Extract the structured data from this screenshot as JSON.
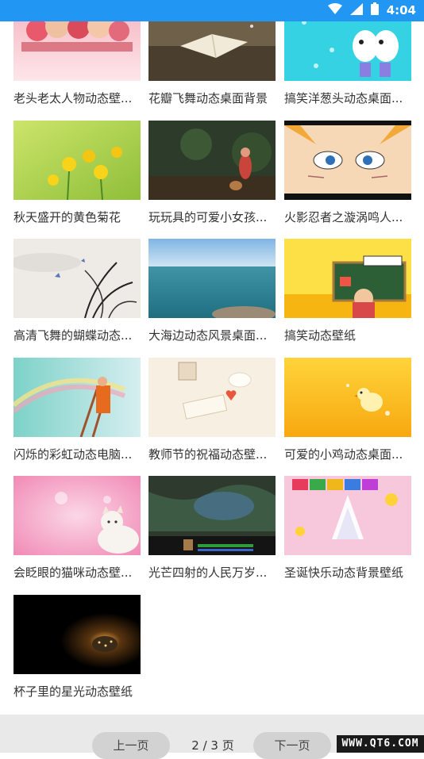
{
  "status_bar": {
    "time": "4:04",
    "icons": [
      "wifi-icon",
      "signal-icon",
      "battery-icon"
    ]
  },
  "wallpapers": [
    {
      "title": "老头老太人物动态壁..."
    },
    {
      "title": "花瓣飞舞动态桌面背景"
    },
    {
      "title": "搞笑洋葱头动态桌面..."
    },
    {
      "title": "秋天盛开的黄色菊花"
    },
    {
      "title": "玩玩具的可爱小女孩..."
    },
    {
      "title": "火影忍者之漩涡鸣人..."
    },
    {
      "title": "高清飞舞的蝴蝶动态..."
    },
    {
      "title": "大海边动态风景桌面..."
    },
    {
      "title": "搞笑动态壁纸"
    },
    {
      "title": "闪烁的彩虹动态电脑..."
    },
    {
      "title": "教师节的祝福动态壁..."
    },
    {
      "title": "可爱的小鸡动态桌面..."
    },
    {
      "title": "会眨眼的猫咪动态壁..."
    },
    {
      "title": "光芒四射的人民万岁..."
    },
    {
      "title": "圣诞快乐动态背景壁纸"
    },
    {
      "title": "杯子里的星光动态壁纸"
    }
  ],
  "pagination": {
    "prev_label": "上一页",
    "page_info": "2 / 3 页",
    "next_label": "下一页"
  },
  "watermark": "WWW.QT6.COM",
  "colors": {
    "status_bar": "#2196f3",
    "pager_bg": "#e9e9e9",
    "button_bg": "#d2d2d2"
  }
}
